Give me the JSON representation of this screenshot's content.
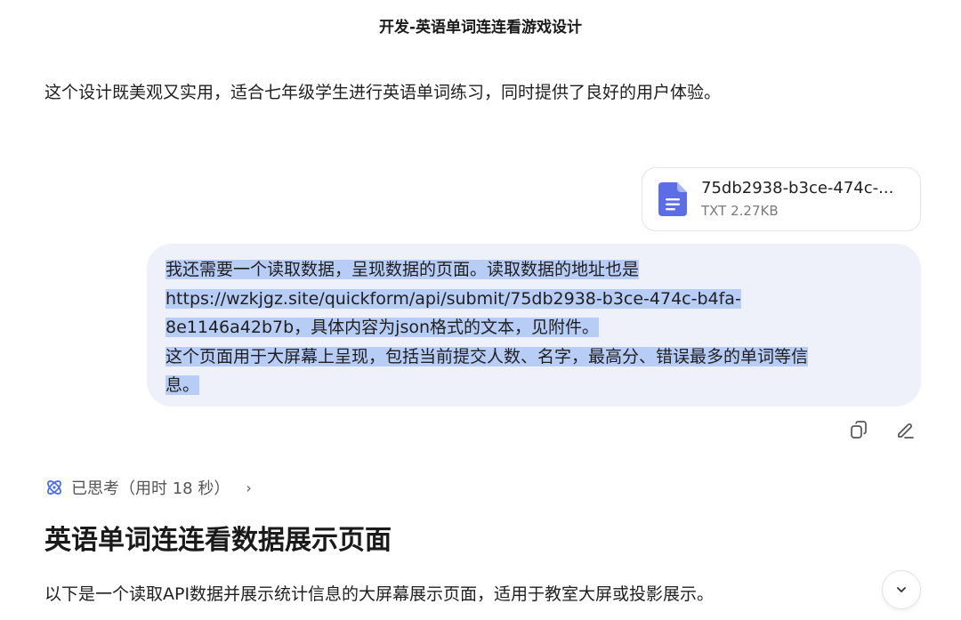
{
  "header": {
    "title": "开发-英语单词连连看游戏设计"
  },
  "previous_message": {
    "text": "这个设计既美观又实用，适合七年级学生进行英语单词练习，同时提供了良好的用户体验。"
  },
  "attachment": {
    "name": "75db2938-b3ce-474c-...",
    "meta": "TXT 2.27KB",
    "icon": "document-icon",
    "icon_color": "#5b6ee8"
  },
  "user_message": {
    "lines": [
      "我还需要一个读取数据，呈现数据的页面。读取数据的地址也是",
      "https://wzkjgz.site/quickform/api/submit/75db2938-b3ce-474c-b4fa-",
      "8e1146a42b7b，具体内容为json格式的文本，见附件。",
      "这个页面用于大屏幕上呈现，包括当前提交人数、名字，最高分、错误最多的单词等信",
      "息。"
    ],
    "selection_color": "#b8cdf6",
    "bubble_color": "#eef1f9"
  },
  "message_actions": [
    {
      "icon": "copy-icon"
    },
    {
      "icon": "edit-icon"
    }
  ],
  "thinking": {
    "label": "已思考（用时 18 秒）",
    "icon": "thinking-icon",
    "accent": "#4d6bfe"
  },
  "answer": {
    "title": "英语单词连连看数据展示页面",
    "intro": "以下是一个读取API数据并展示统计信息的大屏幕展示页面，适用于教室大屏或投影展示。"
  },
  "scroll_button": {
    "icon": "chevron-down-icon"
  }
}
